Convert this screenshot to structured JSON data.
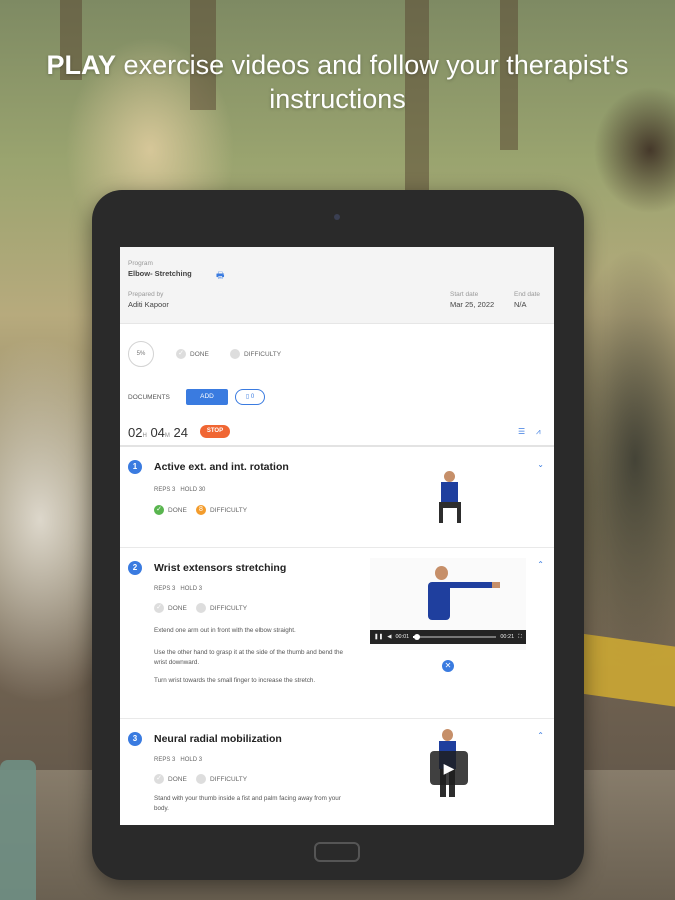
{
  "headline": {
    "strong": "PLAY",
    "rest": " exercise videos and follow your therapist's instructions"
  },
  "program": {
    "program_label": "Program",
    "program_name": "Elbow- Stretching",
    "prepared_by_label": "Prepared by",
    "prepared_by": "Aditi Kapoor",
    "start_date_label": "Start date",
    "start_date": "Mar 25, 2022",
    "end_date_label": "End date",
    "end_date": "N/A"
  },
  "progress": {
    "percent_text": "5%",
    "percent": 5,
    "done_label": "DONE",
    "difficulty_label": "DIFFICULTY"
  },
  "documents": {
    "label": "DOCUMENTS",
    "add_label": "ADD",
    "count": "0"
  },
  "timer": {
    "hours": "02",
    "h_unit": "H",
    "minutes": "04",
    "m_unit": "M",
    "seconds": "24",
    "stop_label": "STOP"
  },
  "exercises": [
    {
      "number": "1",
      "title": "Active ext. and int. rotation",
      "reps_label": "REPS",
      "reps": "3",
      "hold_label": "HOLD",
      "hold": "30",
      "done_label": "DONE",
      "difficulty_label": "DIFFICULTY",
      "difficulty_value": "8"
    },
    {
      "number": "2",
      "title": "Wrist extensors stretching",
      "reps_label": "REPS",
      "reps": "3",
      "hold_label": "HOLD",
      "hold": "3",
      "done_label": "DONE",
      "difficulty_label": "DIFFICULTY",
      "steps": [
        "Extend one arm out in front with the elbow straight.",
        "Use the other hand to grasp it at the side of the thumb and bend the wrist downward.",
        "Turn wrist towards the small finger to increase the stretch."
      ],
      "video": {
        "current": "00:01",
        "duration": "00:21",
        "progress": 0.05
      }
    },
    {
      "number": "3",
      "title": "Neural radial mobilization",
      "reps_label": "REPS",
      "reps": "3",
      "hold_label": "HOLD",
      "hold": "3",
      "done_label": "DONE",
      "difficulty_label": "DIFFICULTY",
      "steps": [
        "Stand with your thumb inside a fist and palm facing away from your body."
      ]
    }
  ],
  "colors": {
    "accent": "#3a7be0",
    "done": "#59b54f",
    "difficulty": "#f39c2c",
    "stop": "#f06633"
  },
  "icons": [
    "print-icon",
    "chevron-down-icon",
    "chevron-up-icon",
    "list-view-icon",
    "chart-icon",
    "pause-icon",
    "volume-icon",
    "fullscreen-icon",
    "close-icon",
    "play-icon",
    "document-icon"
  ]
}
